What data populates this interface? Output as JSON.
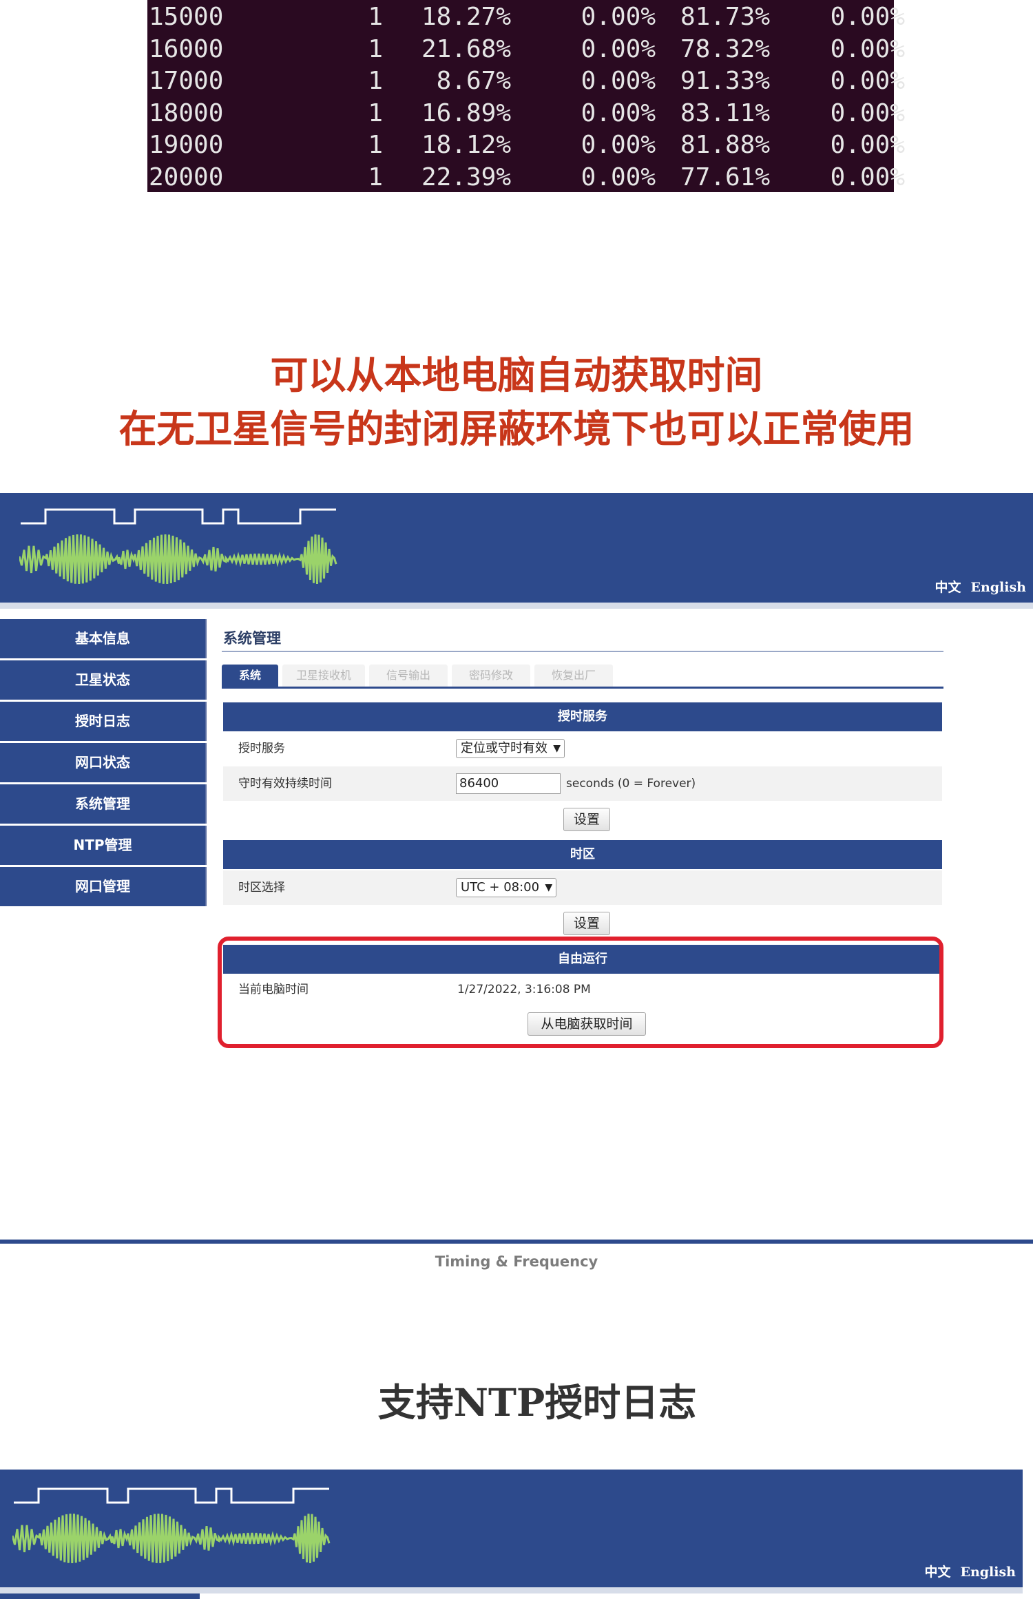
{
  "terminal": {
    "rows": [
      [
        "15000",
        "1",
        "18.27%",
        "0.00%",
        "81.73%",
        "0.00%"
      ],
      [
        "16000",
        "1",
        "21.68%",
        "0.00%",
        "78.32%",
        "0.00%"
      ],
      [
        "17000",
        "1",
        "8.67%",
        "0.00%",
        "91.33%",
        "0.00%"
      ],
      [
        "18000",
        "1",
        "16.89%",
        "0.00%",
        "83.11%",
        "0.00%"
      ],
      [
        "19000",
        "1",
        "18.12%",
        "0.00%",
        "81.88%",
        "0.00%"
      ],
      [
        "20000",
        "1",
        "22.39%",
        "0.00%",
        "77.61%",
        "0.00%"
      ]
    ]
  },
  "promo1": {
    "line1": "可以从本地电脑自动获取时间",
    "line2": "在无卫星信号的封闭屏蔽环境下也可以正常使用"
  },
  "promo2": {
    "line1": "支持NTP授时日志"
  },
  "app": {
    "lang_zh": "中文",
    "lang_en": "English",
    "sidebar": [
      "基本信息",
      "卫星状态",
      "授时日志",
      "网口状态",
      "系统管理",
      "NTP管理",
      "网口管理"
    ],
    "page_title": "系统管理",
    "tabs": [
      "系统",
      "卫星接收机",
      "信号输出",
      "密码修改",
      "恢复出厂"
    ],
    "timing_service": {
      "header": "授时服务",
      "service_label": "授时服务",
      "service_value": "定位或守时有效",
      "hold_label": "守时有效持续时间",
      "hold_value": "86400",
      "hold_hint": "seconds  (0 = Forever)",
      "set_button": "设置"
    },
    "timezone": {
      "header": "时区",
      "select_label": "时区选择",
      "select_value": "UTC + 08:00",
      "set_button": "设置"
    },
    "free_run": {
      "header": "自由运行",
      "pc_time_label": "当前电脑时间",
      "pc_time_value": "1/27/2022, 3:16:08 PM",
      "fetch_button": "从电脑获取时间"
    },
    "footer": "Timing & Frequency"
  },
  "colors": {
    "banner": "#2d4a8c",
    "highlight": "#e0202e",
    "heading_red": "#c8361a",
    "terminal_bg": "#2a0a21",
    "wave_green": "#9bd36a"
  }
}
